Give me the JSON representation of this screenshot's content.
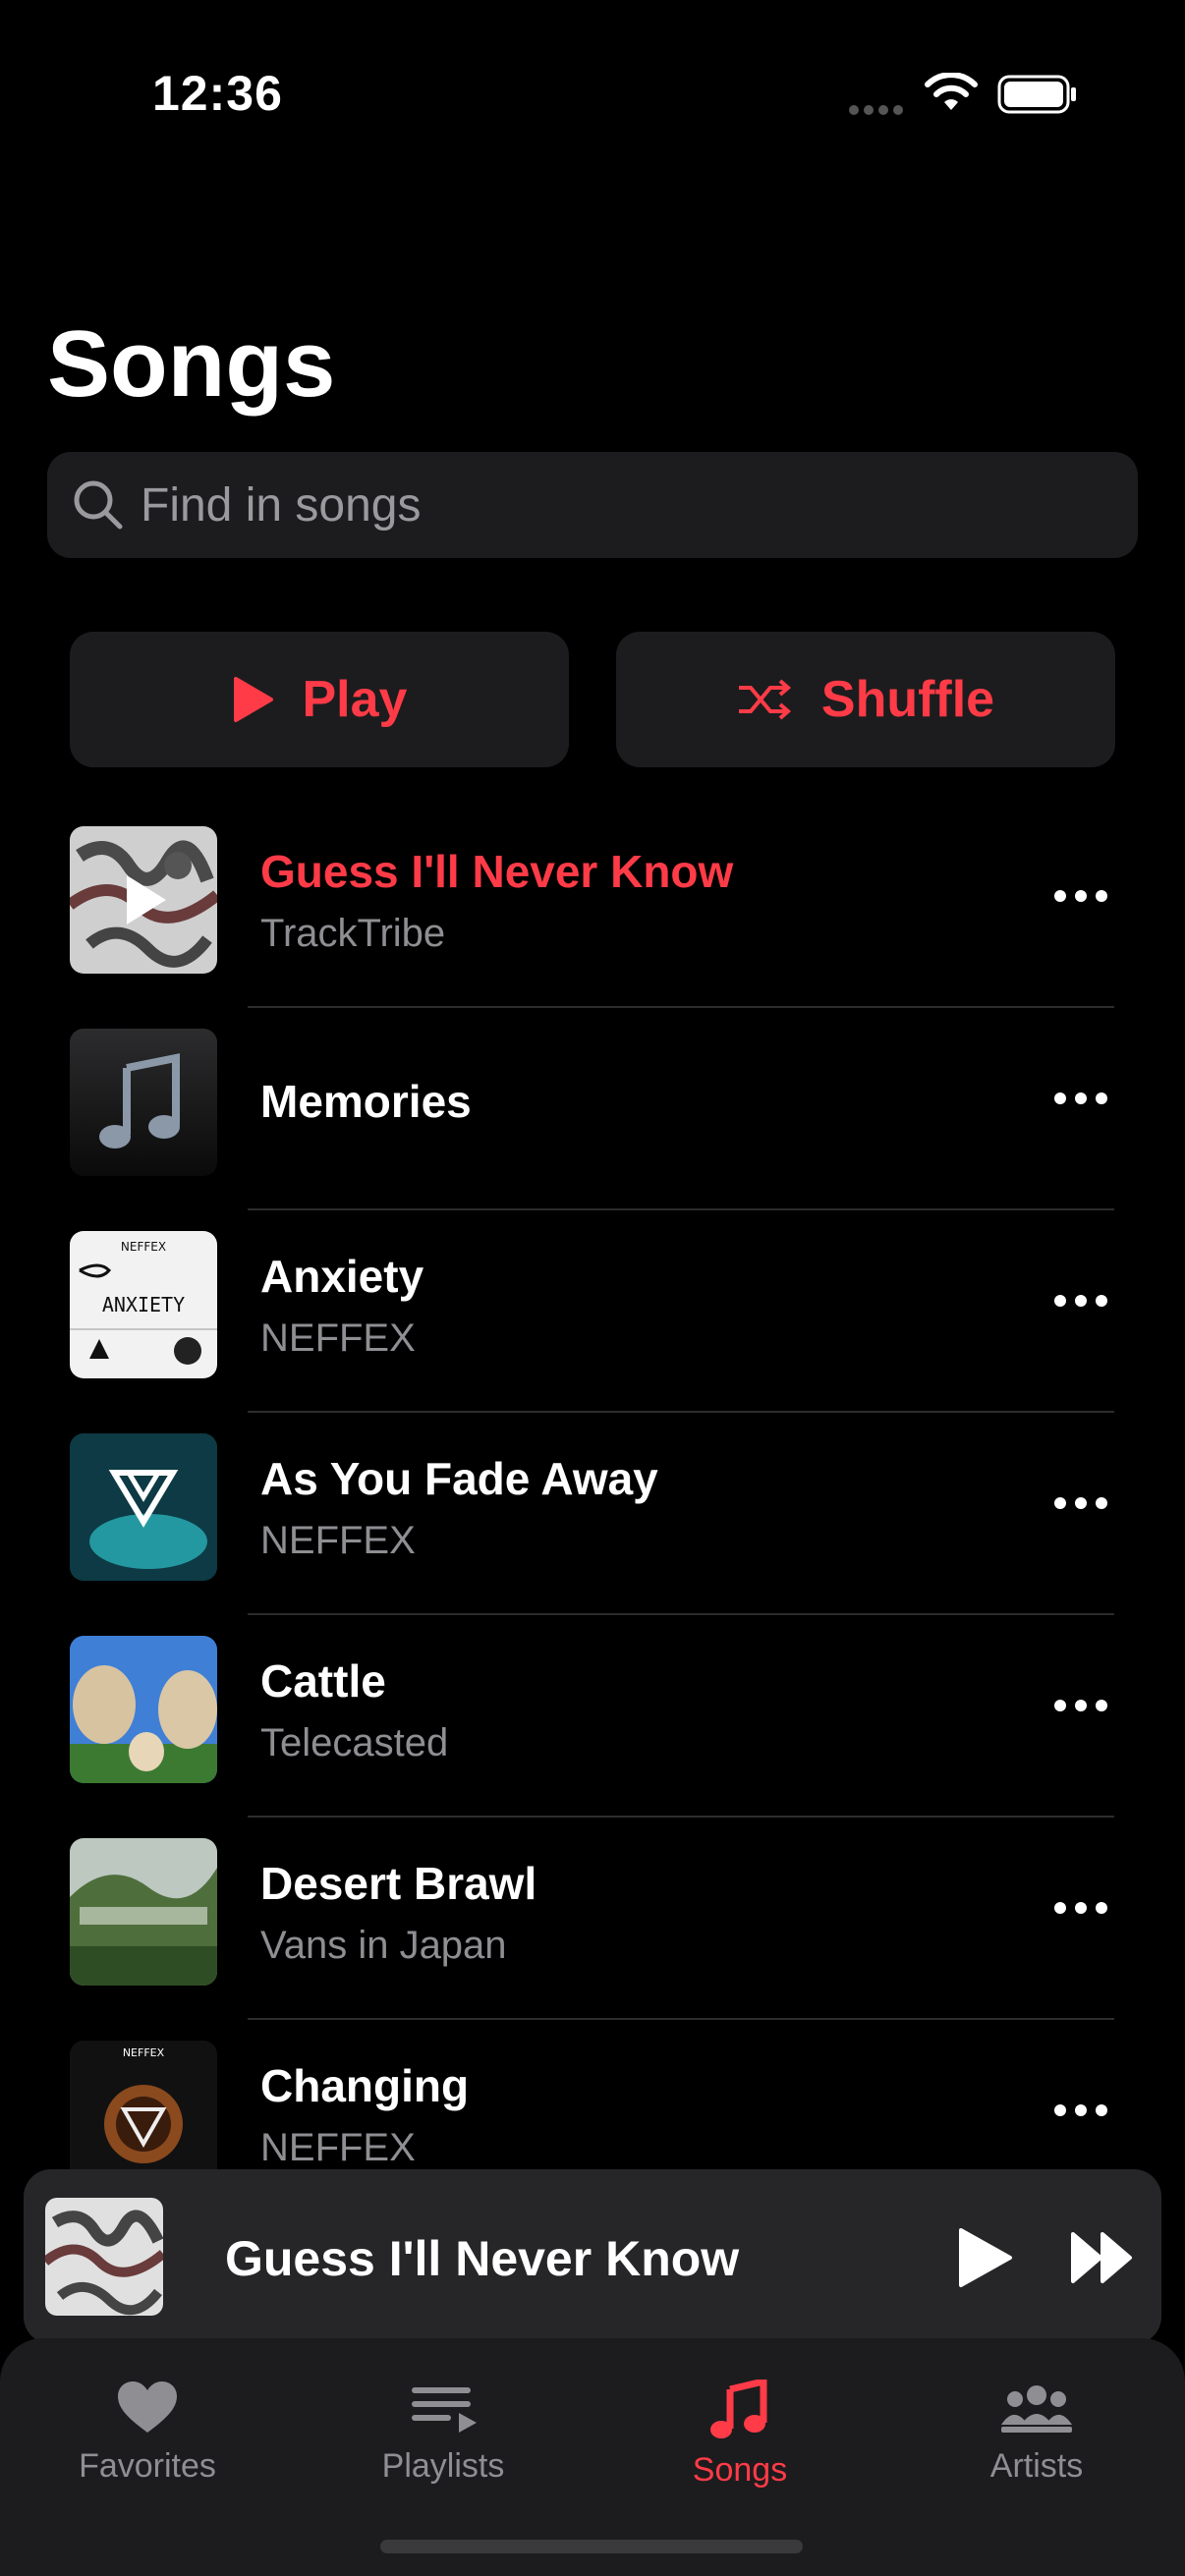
{
  "status_bar": {
    "time": "12:36"
  },
  "page": {
    "title": "Songs"
  },
  "search": {
    "placeholder": "Find in songs"
  },
  "actions": {
    "play_label": "Play",
    "shuffle_label": "Shuffle"
  },
  "colors": {
    "accent": "#ff3b47",
    "background": "#000000",
    "secondary_text": "#8e8e93"
  },
  "songs": [
    {
      "title": "Guess I'll Never Know",
      "artist": "TrackTribe",
      "now_playing": true
    },
    {
      "title": "Memories",
      "artist": ""
    },
    {
      "title": "Anxiety",
      "artist": "NEFFEX"
    },
    {
      "title": "As You Fade Away",
      "artist": "NEFFEX"
    },
    {
      "title": "Cattle",
      "artist": "Telecasted"
    },
    {
      "title": "Desert Brawl",
      "artist": "Vans in Japan"
    },
    {
      "title": "Changing",
      "artist": "NEFFEX"
    }
  ],
  "album_art_text": {
    "anxiety_label": "ANXIETY",
    "neffex_label": "NEFFEX"
  },
  "mini_player": {
    "title": "Guess I'll Never Know"
  },
  "tabs": [
    {
      "label": "Favorites",
      "icon": "heart-icon"
    },
    {
      "label": "Playlists",
      "icon": "playlist-icon"
    },
    {
      "label": "Songs",
      "icon": "music-note-icon",
      "active": true
    },
    {
      "label": "Artists",
      "icon": "people-icon"
    }
  ]
}
